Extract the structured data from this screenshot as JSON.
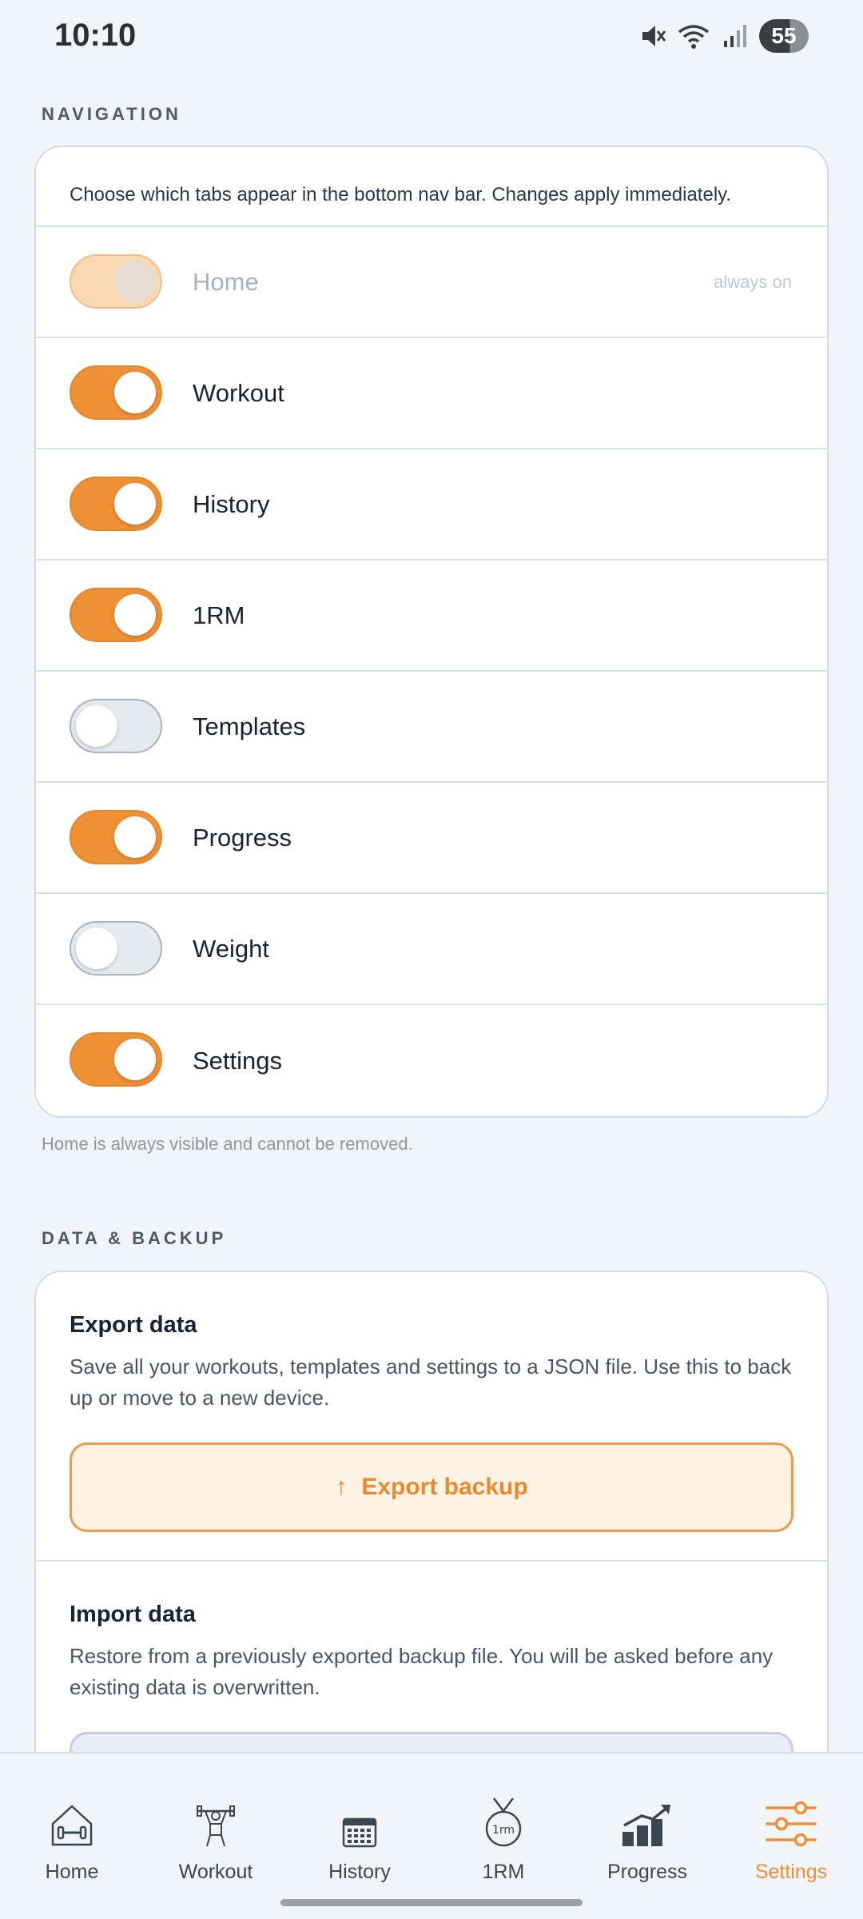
{
  "status_bar": {
    "time": "10:10",
    "battery": "55"
  },
  "navigation": {
    "section_title": "NAVIGATION",
    "description": "Choose which tabs appear in the bottom nav bar. Changes apply immediately.",
    "rows": [
      {
        "label": "Home",
        "enabled": true,
        "locked": true,
        "note": "always on"
      },
      {
        "label": "Workout",
        "enabled": true
      },
      {
        "label": "History",
        "enabled": true
      },
      {
        "label": "1RM",
        "enabled": true
      },
      {
        "label": "Templates",
        "enabled": false
      },
      {
        "label": "Progress",
        "enabled": true
      },
      {
        "label": "Weight",
        "enabled": false
      },
      {
        "label": "Settings",
        "enabled": true
      }
    ],
    "footnote": "Home is always visible and cannot be removed."
  },
  "data_backup": {
    "section_title": "DATA & BACKUP",
    "export": {
      "title": "Export data",
      "description": "Save all your workouts, templates and settings to a JSON file. Use this to back up or move to a new device.",
      "button_icon": "↑",
      "button_label": "Export backup"
    },
    "import": {
      "title": "Import data",
      "description": "Restore from a previously exported backup file. You will be asked before any existing data is overwritten."
    }
  },
  "bottom_nav": {
    "items": [
      {
        "label": "Home",
        "icon": "home-dumbbell-icon"
      },
      {
        "label": "Workout",
        "icon": "lifter-icon"
      },
      {
        "label": "History",
        "icon": "calendar-icon"
      },
      {
        "label": "1RM",
        "icon": "medal-1rm-icon"
      },
      {
        "label": "Progress",
        "icon": "bar-chart-up-icon"
      },
      {
        "label": "Settings",
        "icon": "sliders-icon",
        "active": true
      }
    ],
    "medal_text": "1rm"
  },
  "colors": {
    "accent": "#ee9036",
    "background": "#f1f4f8",
    "card": "#ffffff"
  }
}
